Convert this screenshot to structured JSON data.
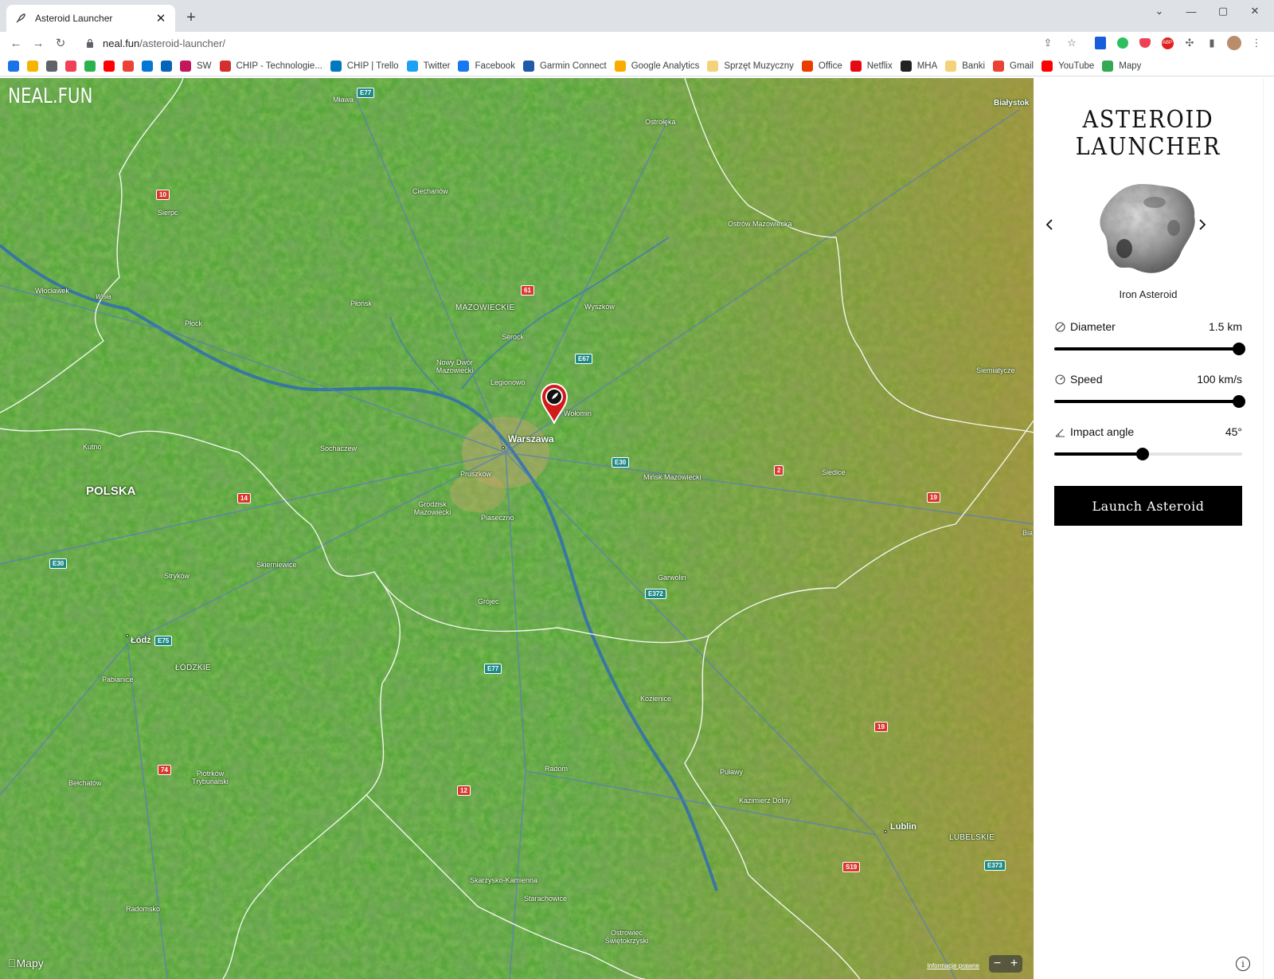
{
  "browser": {
    "tab_title": "Asteroid Launcher",
    "url_host": "neal.fun",
    "url_path": "/asteroid-launcher/",
    "bookmarks": [
      {
        "label": "",
        "icon": "calendar-icon",
        "color": "#1a73e8"
      },
      {
        "label": "",
        "icon": "keep-icon",
        "color": "#f4b400"
      },
      {
        "label": "",
        "icon": "globe-icon",
        "color": "#5f6368"
      },
      {
        "label": "",
        "icon": "pocket-icon",
        "color": "#ef4056"
      },
      {
        "label": "",
        "icon": "feedly-icon",
        "color": "#2bb24c"
      },
      {
        "label": "",
        "icon": "youtube-icon",
        "color": "#ff0000"
      },
      {
        "label": "",
        "icon": "gmail-icon",
        "color": "#ea4335"
      },
      {
        "label": "",
        "icon": "outlook-icon",
        "color": "#0078d4"
      },
      {
        "label": "",
        "icon": "onedrive-icon",
        "color": "#0364b8"
      },
      {
        "label": "SW",
        "icon": "sw-icon",
        "color": "#c2185b"
      },
      {
        "label": "CHIP - Technologie...",
        "icon": "chip-icon",
        "color": "#d32f2f"
      },
      {
        "label": "CHIP | Trello",
        "icon": "trello-icon",
        "color": "#0079bf"
      },
      {
        "label": "Twitter",
        "icon": "twitter-icon",
        "color": "#1da1f2"
      },
      {
        "label": "Facebook",
        "icon": "facebook-icon",
        "color": "#1877f2"
      },
      {
        "label": "Garmin Connect",
        "icon": "garmin-icon",
        "color": "#1f5aa6"
      },
      {
        "label": "Google Analytics",
        "icon": "analytics-icon",
        "color": "#f9ab00"
      },
      {
        "label": "Sprzęt Muzyczny",
        "icon": "folder-icon",
        "color": "#f2d37a"
      },
      {
        "label": "Office",
        "icon": "office-icon",
        "color": "#eb3c00"
      },
      {
        "label": "Netflix",
        "icon": "netflix-icon",
        "color": "#e50914"
      },
      {
        "label": "MHA",
        "icon": "mha-icon",
        "color": "#222222"
      },
      {
        "label": "Banki",
        "icon": "folder-icon",
        "color": "#f2d37a"
      },
      {
        "label": "Gmail",
        "icon": "gmail-icon",
        "color": "#ea4335"
      },
      {
        "label": "YouTube",
        "icon": "youtube-icon",
        "color": "#ff0000"
      },
      {
        "label": "Mapy",
        "icon": "maps-icon",
        "color": "#34a853"
      }
    ]
  },
  "map": {
    "logo": "NEAL.FUN",
    "brand": "Mapy",
    "legal": "Informacje prawne",
    "zoom_out": "−",
    "zoom_in": "+",
    "country": "POLSKA",
    "regions": [
      "MAZOWIECKIE",
      "ŁÓDZKIE",
      "LUBELSKIE"
    ],
    "cities": [
      "Mława",
      "Ostrołęka",
      "Białystok",
      "Ciechanów",
      "Sierpc",
      "Ostrów Mazowiecka",
      "Włocławek",
      "Płońsk",
      "Wyszków",
      "Płock",
      "Serock",
      "Nowy Dwór Mazowiecki",
      "Legionowo",
      "Wołomin",
      "Siemiatycze",
      "Warszawa",
      "Kutno",
      "Sochaczew",
      "Pruszków",
      "Mińsk Mazowiecki",
      "Siedlce",
      "Grodzisk Mazowiecki",
      "Piaseczno",
      "Skierniewice",
      "Stryków",
      "Garwolin",
      "Grójec",
      "Łódź",
      "Pabianice",
      "Kozienice",
      "Piotrków Trybunalski",
      "Bełchatów",
      "Radom",
      "Puławy",
      "Kazimierz Dolny",
      "Lublin",
      "Skarżysko-Kamienna",
      "Starachowice",
      "Radomsko",
      "Ostrowiec Świętokrzyski",
      "Wisła",
      "Bia"
    ],
    "shields": [
      "E77",
      "10",
      "61",
      "E67",
      "E30",
      "2",
      "14",
      "19",
      "E372",
      "E75",
      "E77",
      "19",
      "74",
      "12",
      "S19",
      "E373",
      "E30"
    ]
  },
  "panel": {
    "title_line1": "ASTEROID",
    "title_line2": "LAUNCHER",
    "asteroid_name": "Iron Asteroid",
    "controls": [
      {
        "label": "Diameter",
        "value": "1.5 km",
        "level": 1.0,
        "icon": "diameter-icon"
      },
      {
        "label": "Speed",
        "value": "100 km/s",
        "level": 1.0,
        "icon": "speedometer-icon"
      },
      {
        "label": "Impact angle",
        "value": "45°",
        "level": 0.47,
        "icon": "angle-icon"
      }
    ],
    "launch_label": "Launch Asteroid",
    "info_label": "i"
  },
  "colors": {
    "accent": "#000000",
    "pin": "#d11a1a",
    "map_green": "#4e9a33"
  }
}
